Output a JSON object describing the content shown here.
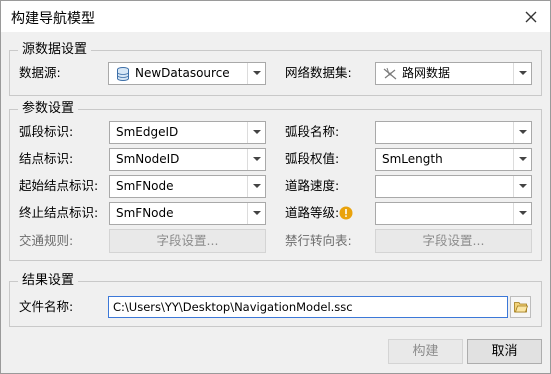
{
  "window": {
    "title": "构建导航模型"
  },
  "source_group": {
    "title": "源数据设置",
    "datasource_label": "数据源:",
    "datasource_value": "NewDatasource",
    "dataset_label": "网络数据集:",
    "dataset_value": "路网数据"
  },
  "param_group": {
    "title": "参数设置",
    "edge_id_label": "弧段标识:",
    "edge_id_value": "SmEdgeID",
    "edge_name_label": "弧段名称:",
    "edge_name_value": "",
    "node_id_label": "结点标识:",
    "node_id_value": "SmNodeID",
    "edge_weight_label": "弧段权值:",
    "edge_weight_value": "SmLength",
    "fnode_label": "起始结点标识:",
    "fnode_value": "SmFNode",
    "road_speed_label": "道路速度:",
    "road_speed_value": "",
    "tnode_label": "终止结点标识:",
    "tnode_value": "SmFNode",
    "road_level_label": "道路等级:",
    "road_level_value": "",
    "traffic_rule_label": "交通规则:",
    "traffic_rule_button": "字段设置...",
    "turn_table_label": "禁行转向表:",
    "turn_table_button": "字段设置..."
  },
  "result_group": {
    "title": "结果设置",
    "file_label": "文件名称:",
    "file_value": "C:\\Users\\YY\\Desktop\\NavigationModel.ssc"
  },
  "footer": {
    "build_button": "构建",
    "cancel_button": "取消"
  }
}
